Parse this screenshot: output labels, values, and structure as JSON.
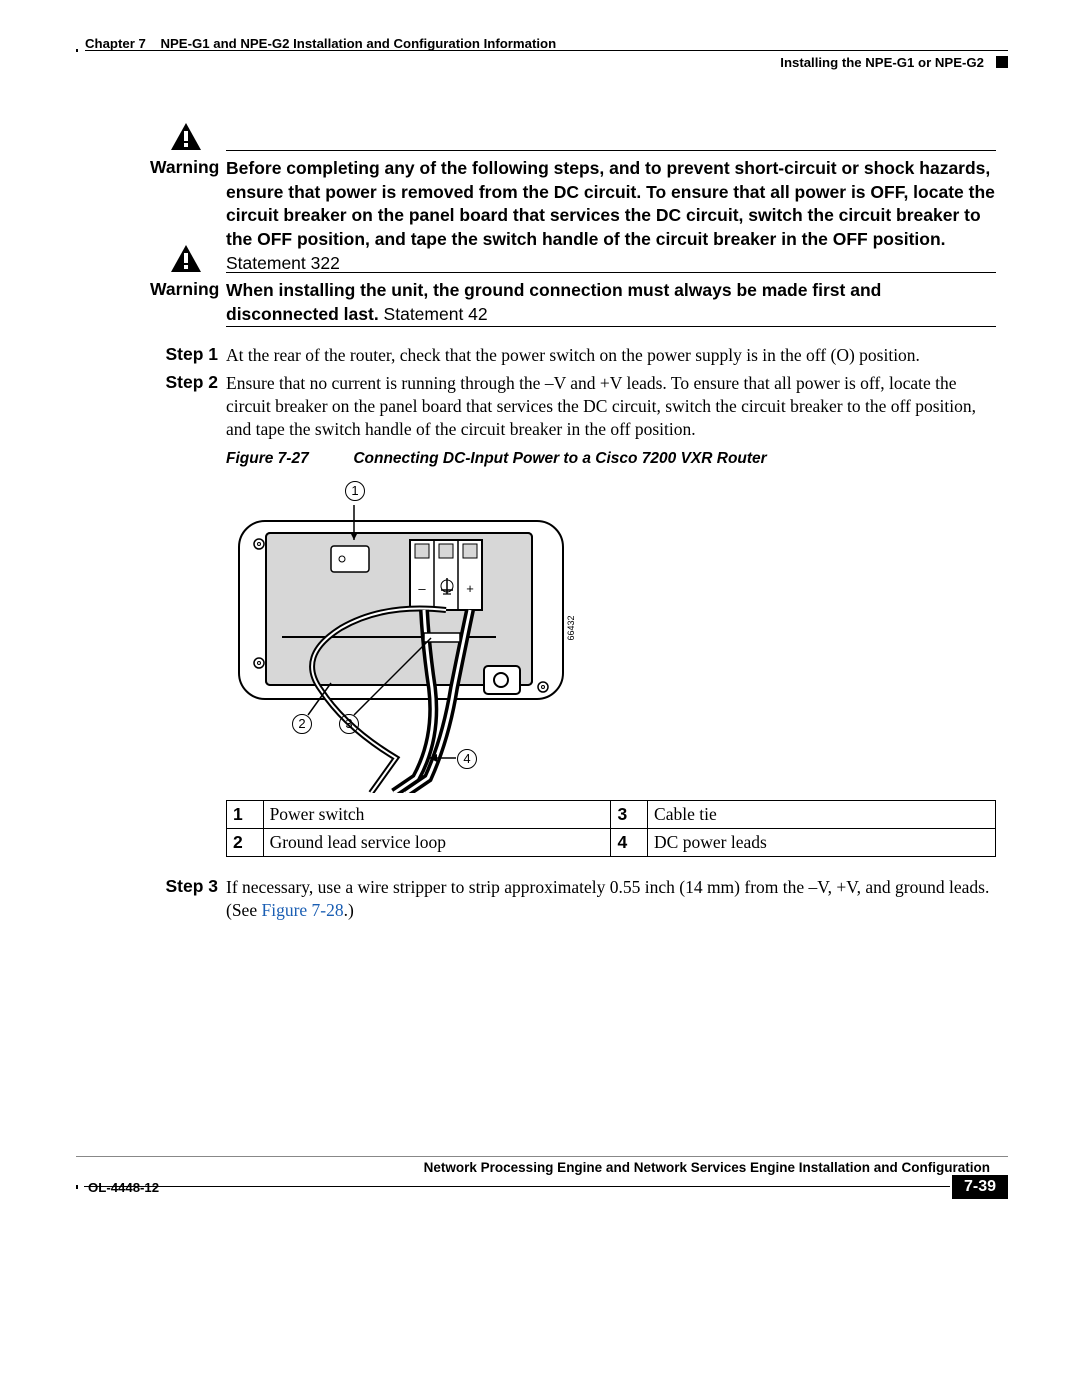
{
  "header": {
    "chapter_prefix": "Chapter 7",
    "chapter_title": "NPE-G1 and NPE-G2 Installation and Configuration Information",
    "section": "Installing the NPE-G1 or NPE-G2"
  },
  "warnings": [
    {
      "label": "Warning",
      "bold_text": "Before completing any of the following steps, and to prevent short-circuit or shock hazards, ensure that power is removed from the DC circuit. To ensure that all power is OFF, locate the circuit breaker on the panel board that services the DC circuit, switch the circuit breaker to the OFF position, and tape the switch handle of the circuit breaker in the OFF position.",
      "tail": " Statement 322"
    },
    {
      "label": "Warning",
      "bold_text": "When installing the unit, the ground connection must always be made first and disconnected last.",
      "tail": " Statement 42"
    }
  ],
  "steps": {
    "s1": {
      "label": "Step 1",
      "text": "At the rear of the router, check that the power switch on the power supply is in the off (O) position."
    },
    "s2": {
      "label": "Step 2",
      "text": "Ensure that no current is running through the –V and +V leads. To ensure that all power is off, locate the circuit breaker on the panel board that services the DC circuit, switch the circuit breaker to the off position, and tape the switch handle of the circuit breaker in the off position."
    },
    "s3": {
      "label": "Step 3",
      "pre": "If necessary, use a wire stripper to strip approximately 0.55 inch (14 mm) from the –V, +V, and ground leads. (See ",
      "link": "Figure 7-28",
      "post": ".)"
    }
  },
  "figure": {
    "label": "Figure 7-27",
    "caption": "Connecting DC-Input Power to a Cisco 7200 VXR Router",
    "image_id": "66432",
    "callouts": {
      "c1": "1",
      "c2": "2",
      "c3": "3",
      "c4": "4"
    },
    "legend": [
      {
        "n": "1",
        "t": "Power switch"
      },
      {
        "n": "3",
        "t": "Cable tie"
      },
      {
        "n": "2",
        "t": "Ground lead service loop"
      },
      {
        "n": "4",
        "t": "DC power leads"
      }
    ]
  },
  "footer": {
    "title": "Network Processing Engine and Network Services Engine Installation and Configuration",
    "doc_id": "OL-4448-12",
    "page": "7-39"
  }
}
